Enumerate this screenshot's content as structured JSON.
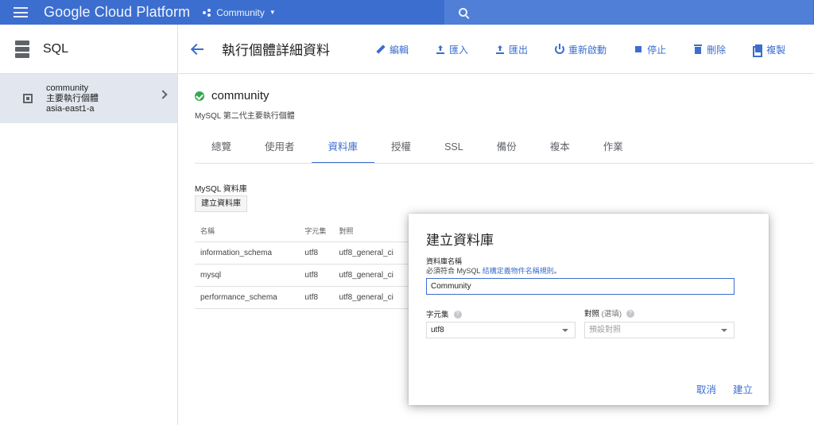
{
  "topbar": {
    "brand": "Google Cloud Platform",
    "project": "Community",
    "search_placeholder": ""
  },
  "sidebar": {
    "title": "SQL",
    "instance": {
      "name": "community",
      "role": "主要執行個體",
      "zone": "asia-east1-a"
    }
  },
  "toolbar": {
    "title": "執行個體詳細資料",
    "actions": {
      "edit": "編輯",
      "import": "匯入",
      "export": "匯出",
      "restart": "重新啟動",
      "stop": "停止",
      "delete": "刪除",
      "clone": "複製"
    }
  },
  "instance": {
    "name": "community",
    "description": "MySQL 第二代主要執行個體"
  },
  "tabs": {
    "overview": "總覽",
    "users": "使用者",
    "databases": "資料庫",
    "authorization": "授權",
    "ssl": "SSL",
    "backups": "備份",
    "replicas": "複本",
    "operations": "作業"
  },
  "databases": {
    "section_title": "MySQL 資料庫",
    "create_button": "建立資料庫",
    "columns": {
      "name": "名稱",
      "charset": "字元集",
      "collation": "對照"
    },
    "rows": [
      {
        "name": "information_schema",
        "charset": "utf8",
        "collation": "utf8_general_ci"
      },
      {
        "name": "mysql",
        "charset": "utf8",
        "collation": "utf8_general_ci"
      },
      {
        "name": "performance_schema",
        "charset": "utf8",
        "collation": "utf8_general_ci"
      }
    ]
  },
  "dialog": {
    "title": "建立資料庫",
    "name_label": "資料庫名稱",
    "hint_prefix": "必須符合 MySQL ",
    "hint_link": "結構定義物件名稱規則",
    "hint_suffix": "。",
    "name_value": "Community",
    "charset_label": "字元集",
    "charset_value": "utf8",
    "collation_label": "對照",
    "collation_optional": "(選填)",
    "collation_placeholder": "預設對照",
    "help_glyph": "?",
    "cancel": "取消",
    "create": "建立"
  },
  "colors": {
    "accent": "#3b6ecf",
    "success": "#34a853",
    "selected_row": "#e2e6ee"
  }
}
